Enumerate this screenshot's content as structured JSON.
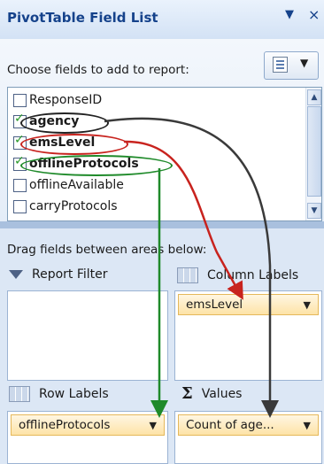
{
  "panel": {
    "title": "PivotTable Field List",
    "menu_glyph": "▼",
    "close_glyph": "×"
  },
  "top": {
    "choose_label": "Choose fields to add to report:",
    "layout_button_arrow": "▼",
    "fields": [
      {
        "label": "ResponseID",
        "checked": false
      },
      {
        "label": "agency",
        "checked": true,
        "circle": "black"
      },
      {
        "label": "emsLevel",
        "checked": true,
        "circle": "red"
      },
      {
        "label": "offlineProtocols",
        "checked": true,
        "circle": "green"
      },
      {
        "label": "offlineAvailable",
        "checked": false
      },
      {
        "label": "carryProtocols",
        "checked": false
      }
    ]
  },
  "areas": {
    "drag_label": "Drag fields between areas below:",
    "report_filter": {
      "label": "Report Filter",
      "icon": "filter-icon"
    },
    "column_labels": {
      "label": "Column Labels",
      "icon": "column-grid-icon",
      "field": "emsLevel"
    },
    "row_labels": {
      "label": "Row Labels",
      "icon": "row-grid-icon",
      "field": "offlineProtocols"
    },
    "values": {
      "label": "Values",
      "icon": "sigma-icon",
      "field": "Count of age..."
    }
  },
  "colors": {
    "arrow_black": "#3a3a3a",
    "arrow_red": "#c8231e",
    "arrow_green": "#1f8a2a",
    "pill_bg": "#fde3a7"
  }
}
